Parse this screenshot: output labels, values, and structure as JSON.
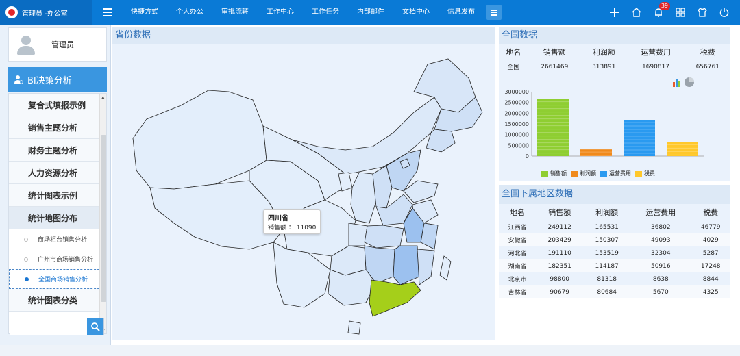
{
  "header": {
    "brand": "管理员 -办公室",
    "nav": [
      "快捷方式",
      "个人办公",
      "审批流转",
      "工作中心",
      "工作任务",
      "内部邮件",
      "文档中心",
      "信息发布"
    ],
    "badge_count": "39",
    "icons": [
      "plus-icon",
      "home-icon",
      "bell-icon",
      "grid-icon",
      "shirt-icon",
      "power-icon"
    ]
  },
  "sidebar": {
    "user_name": "管理员",
    "section_title": "BI决策分析",
    "menu": [
      "复合式填报示例",
      "销售主题分析",
      "财务主题分析",
      "人力资源分析",
      "统计图表示例",
      "统计地图分布"
    ],
    "sub_items": [
      "商场柜台销售分析",
      "广州市商场销售分析",
      "全国商场销售分析"
    ],
    "after_menu": "统计图表分类",
    "search_placeholder": ""
  },
  "map_panel": {
    "title": "省份数据",
    "tooltip_title": "四川省",
    "tooltip_label": "销售额 ：",
    "tooltip_value": "11090",
    "highlight_color": "#a5cf1a",
    "base_color": "#e3eefb"
  },
  "national": {
    "title": "全国数据",
    "headers": [
      "地名",
      "销售额",
      "利润额",
      "运营费用",
      "税费"
    ],
    "row": [
      "全国",
      "2661469",
      "313891",
      "1690817",
      "656761"
    ]
  },
  "chart_data": {
    "type": "bar",
    "categories": [
      "销售额",
      "利润额",
      "运营费用",
      "税费"
    ],
    "values": [
      2661469,
      313891,
      1690817,
      656761
    ],
    "colors": [
      "#8fce32",
      "#f08a1c",
      "#2a9af0",
      "#ffc82c"
    ],
    "yticks": [
      "3000000",
      "2500000",
      "2000000",
      "1500000",
      "1000000",
      "500000",
      "0"
    ],
    "ylim": [
      0,
      3000000
    ],
    "legend": [
      "销售额",
      "利润额",
      "运营费用",
      "税费"
    ],
    "legend_position": "bottom"
  },
  "regions": {
    "title": "全国下属地区数据",
    "headers": [
      "地名",
      "销售额",
      "利润额",
      "运营费用",
      "税费"
    ],
    "rows": [
      [
        "江西省",
        "249112",
        "165531",
        "36802",
        "46779"
      ],
      [
        "安徽省",
        "203429",
        "150307",
        "49093",
        "4029"
      ],
      [
        "河北省",
        "191110",
        "153519",
        "32304",
        "5287"
      ],
      [
        "湖南省",
        "182351",
        "114187",
        "50916",
        "17248"
      ],
      [
        "北京市",
        "98800",
        "81318",
        "8638",
        "8844"
      ],
      [
        "吉林省",
        "90679",
        "80684",
        "5670",
        "4325"
      ]
    ]
  }
}
